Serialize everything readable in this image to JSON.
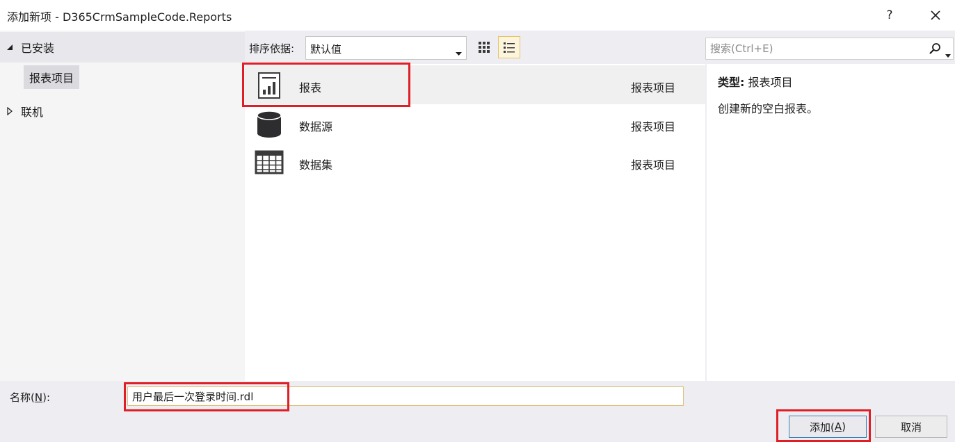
{
  "window": {
    "title": "添加新项 - D365CrmSampleCode.Reports",
    "help_label": "?",
    "close_icon": "close-icon"
  },
  "sidebar": {
    "installed_label": "已安装",
    "installed_items": [
      "报表项目"
    ],
    "online_label": "联机"
  },
  "toolbar": {
    "sort_label": "排序依据:",
    "sort_value": "默认值",
    "view_grid_icon": "grid-view-icon",
    "view_list_icon": "list-view-icon",
    "search_placeholder": "搜索(Ctrl+E)"
  },
  "templates": [
    {
      "name": "报表",
      "type": "报表项目",
      "icon": "report-icon",
      "selected": true
    },
    {
      "name": "数据源",
      "type": "报表项目",
      "icon": "database-icon",
      "selected": false
    },
    {
      "name": "数据集",
      "type": "报表项目",
      "icon": "table-icon",
      "selected": false
    }
  ],
  "details": {
    "type_key": "类型:",
    "type_value": "报表项目",
    "description": "创建新的空白报表。"
  },
  "bottom": {
    "name_label_prefix": "名称(",
    "name_label_key": "N",
    "name_label_suffix": "):",
    "name_value": "用户最后一次登录时间.rdl",
    "add_label_prefix": "添加(",
    "add_label_key": "A",
    "add_label_suffix": ")",
    "cancel_label": "取消"
  },
  "colors": {
    "highlight": "#e01e26",
    "selected_view": "#fcf4dd",
    "dialog_bg": "#eeeef2"
  }
}
